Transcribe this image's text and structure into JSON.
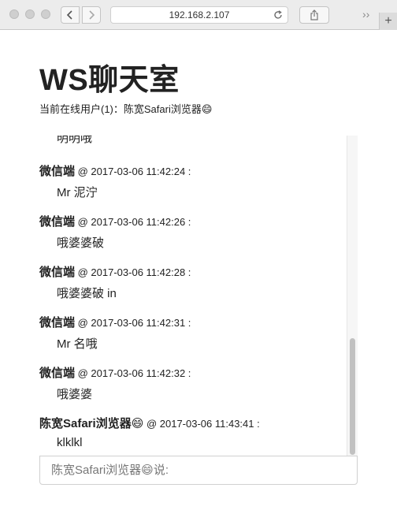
{
  "browser": {
    "url": "192.168.2.107",
    "overflow_label": "››",
    "new_tab_label": "+"
  },
  "page": {
    "title": "WS聊天室",
    "online_users_text": "当前在线用户(1)：陈宽Safari浏览器😄"
  },
  "messages": {
    "partial_text": "明明哦",
    "items": [
      {
        "sender": "微信端",
        "meta": " @ 2017-03-06 11:42:24 :",
        "text": "Mr 泥泞"
      },
      {
        "sender": "微信端",
        "meta": " @ 2017-03-06 11:42:26 :",
        "text": "哦婆婆破"
      },
      {
        "sender": "微信端",
        "meta": " @ 2017-03-06 11:42:28 :",
        "text": "哦婆婆破 in"
      },
      {
        "sender": "微信端",
        "meta": " @ 2017-03-06 11:42:31 :",
        "text": "Mr 名哦"
      },
      {
        "sender": "微信端",
        "meta": " @ 2017-03-06 11:42:32 :",
        "text": "哦婆婆"
      },
      {
        "sender": "陈宽Safari浏览器😄",
        "meta": " @ 2017-03-06 11:43:41 :",
        "text": "klklkl"
      }
    ]
  },
  "scroll": {
    "position_fraction": 1.0
  },
  "compose": {
    "placeholder": "陈宽Safari浏览器😄说:",
    "value": ""
  }
}
